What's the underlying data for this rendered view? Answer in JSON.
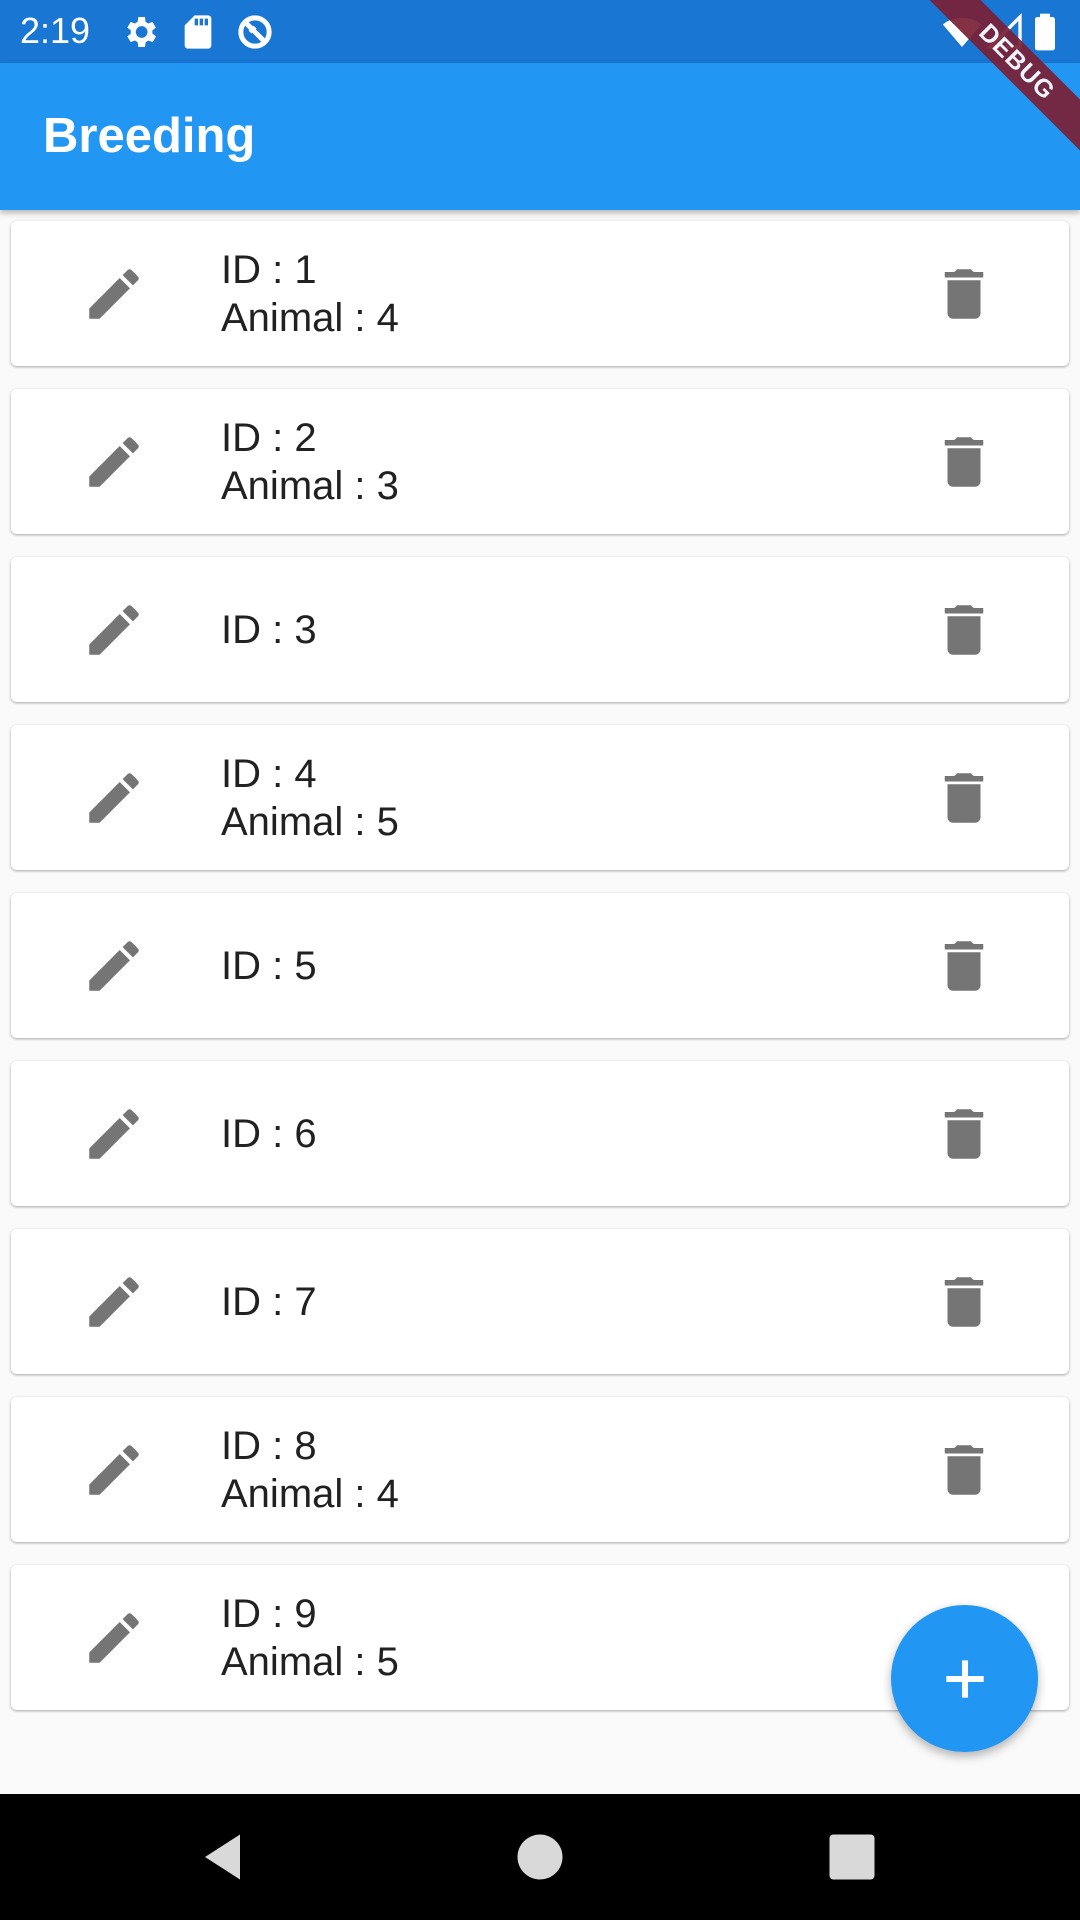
{
  "status_bar": {
    "time": "2:19",
    "icons": [
      "settings-icon",
      "sd-card-icon",
      "sync-blocked-icon",
      "wifi-icon",
      "signal-icon",
      "battery-icon"
    ]
  },
  "app_bar": {
    "title": "Breeding",
    "color": "#2196f3",
    "debug_label": "DEBUG"
  },
  "items": [
    {
      "id_text": "ID : 1",
      "animal_text": "Animal : 4"
    },
    {
      "id_text": "ID : 2",
      "animal_text": "Animal : 3"
    },
    {
      "id_text": "ID : 3",
      "animal_text": ""
    },
    {
      "id_text": "ID : 4",
      "animal_text": "Animal : 5"
    },
    {
      "id_text": "ID : 5",
      "animal_text": ""
    },
    {
      "id_text": "ID : 6",
      "animal_text": ""
    },
    {
      "id_text": "ID : 7",
      "animal_text": ""
    },
    {
      "id_text": "ID : 8",
      "animal_text": "Animal : 4"
    },
    {
      "id_text": "ID : 9",
      "animal_text": "Animal : 5"
    }
  ],
  "item_icons": {
    "edit": "edit-icon",
    "delete": "delete-icon"
  },
  "fab": {
    "icon": "add-icon",
    "color": "#2196f3"
  },
  "nav_bar": {
    "icons": [
      "back-icon",
      "home-icon",
      "recents-icon"
    ]
  }
}
